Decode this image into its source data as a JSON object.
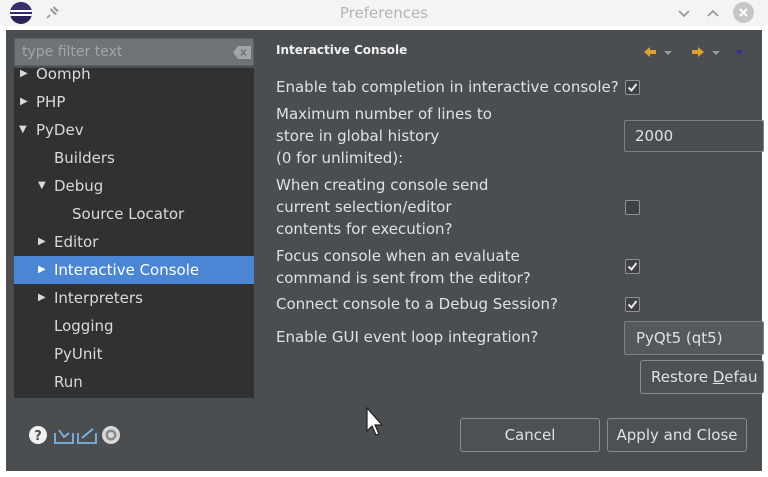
{
  "window": {
    "title": "Preferences"
  },
  "filter": {
    "placeholder": "type filter text"
  },
  "tree": {
    "items": [
      {
        "label": "Oomph",
        "expanded": false
      },
      {
        "label": "PHP",
        "expanded": false
      },
      {
        "label": "PyDev",
        "expanded": true
      },
      {
        "label": "Builders"
      },
      {
        "label": "Debug",
        "expanded": true
      },
      {
        "label": "Source Locator"
      },
      {
        "label": "Editor",
        "expanded": false
      },
      {
        "label": "Interactive Console",
        "expanded": false,
        "selected": true
      },
      {
        "label": "Interpreters",
        "expanded": false
      },
      {
        "label": "Logging"
      },
      {
        "label": "PyUnit"
      },
      {
        "label": "Run"
      }
    ]
  },
  "page": {
    "title": "Interactive Console",
    "tab_completion": {
      "label": "Enable tab completion in interactive console?",
      "checked": true
    },
    "history_lines": {
      "label_line1": "Maximum number of lines to",
      "label_line2": "store in global history",
      "label_line3": "(0 for unlimited):",
      "value": "2000"
    },
    "send_selection": {
      "label_line1": "When creating console send",
      "label_line2": "current selection/editor",
      "label_line3": "contents for execution?",
      "checked": false
    },
    "focus_console": {
      "label_line1": "Focus console when an evaluate",
      "label_line2": "command is sent from the editor?",
      "checked": true
    },
    "debug_session": {
      "label": "Connect console to a Debug Session?",
      "checked": true
    },
    "gui_loop": {
      "label": "Enable GUI event loop integration?",
      "value": "PyQt5 (qt5)"
    },
    "restore_defaults": {
      "label_pre": "Restore ",
      "label_mnemonic": "D",
      "label_post": "efau"
    }
  },
  "buttons": {
    "cancel": "Cancel",
    "apply_close": "Apply and Close"
  },
  "colors": {
    "selection": "#4a86d4",
    "dialog_bg": "#4b4e51",
    "tree_bg": "#2f3133",
    "nav_arrow": "#e0a030",
    "eclipse_purple": "#2c2255"
  }
}
